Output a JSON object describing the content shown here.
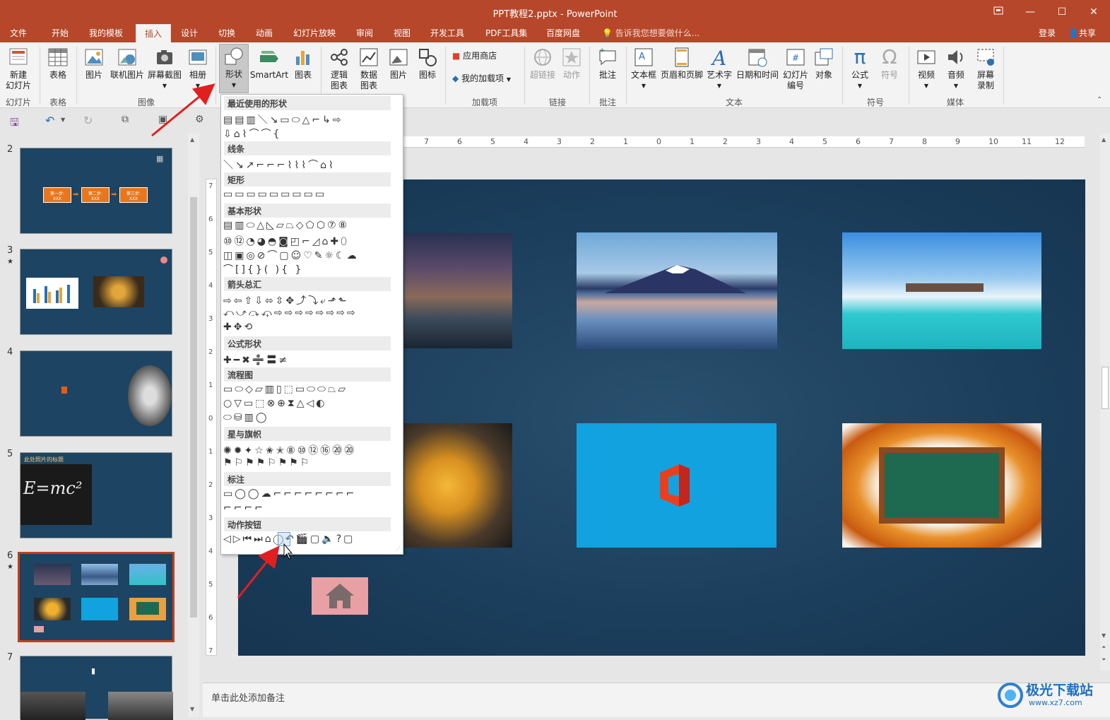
{
  "window": {
    "title": "PPT教程2.pptx - PowerPoint",
    "restore_icon": "ribbon-display-icon",
    "minimize": "—",
    "maximize": "☐",
    "close": "✕"
  },
  "menu": {
    "tabs": [
      "文件",
      "开始",
      "我的模板",
      "插入",
      "设计",
      "切换",
      "动画",
      "幻灯片放映",
      "审阅",
      "视图",
      "开发工具",
      "PDF工具集",
      "百度网盘"
    ],
    "active": "插入",
    "tellme": "告诉我您想要做什么...",
    "login": "登录",
    "share": "共享"
  },
  "ribbon": {
    "buttons": {
      "new_slide": "新建\n幻灯片",
      "table": "表格",
      "picture": "图片",
      "online_picture": "联机图片",
      "screenshot": "屏幕截图",
      "album": "相册",
      "shapes": "形状",
      "smartart": "SmartArt",
      "chart": "图表",
      "logic_chart": "逻辑\n图表",
      "data_chart": "数据\n图表",
      "pic2": "图片",
      "icon": "图标",
      "store": "应用商店",
      "my_addins": "我的加载项",
      "hyperlink": "超链接",
      "action": "动作",
      "comment": "批注",
      "textbox": "文本框",
      "header_footer": "页眉和页脚",
      "wordart": "艺术字",
      "datetime": "日期和时间",
      "slide_number": "幻灯片\n编号",
      "object": "对象",
      "equation": "公式",
      "symbol": "符号",
      "video": "视频",
      "audio": "音频",
      "screen_record": "屏幕\n录制"
    },
    "groups": {
      "slides": "幻灯片",
      "tables": "表格",
      "images": "图像",
      "addins": "加载项",
      "links": "链接",
      "comments": "批注",
      "text": "文本",
      "symbols": "符号",
      "media": "媒体"
    }
  },
  "shapes_menu": {
    "sections": [
      "最近使用的形状",
      "线条",
      "矩形",
      "基本形状",
      "箭头总汇",
      "公式形状",
      "流程图",
      "星与旗帜",
      "标注",
      "动作按钮"
    ],
    "rows": {
      "recent": [
        "▤▤▥＼↘▭⬭△⌐↳⇨",
        "⇩⌂⌇⌒⌒{"
      ],
      "lines": [
        "＼↘↗⌐⌐⌐⌇⌇⌇⌒⌂⌇"
      ],
      "rect": [
        "▭▭▭▭▭▭▭▭▭"
      ],
      "basic": [
        "▤▥⬭△◺▱⏢◇⬠⬡⑦⑧",
        "⑩⑫◔◕◓◙◰⌐◿⌂✚⬯",
        "◫▣◎⊘⌒▢☺♡✎☼☾☁",
        "⌒[]{}( ){ }"
      ],
      "arrows": [
        "⇨⇦⇧⇩⬄⇳✥⤴⤵⤶⬏⬑",
        "⤺⤻⤼⤽⇨⇨⇨⇨⇨⇨⇨⇨",
        "✚✥⟲"
      ],
      "equation": [
        "✚━✖➗〓≠"
      ],
      "flow": [
        "▭⬭◇▱▥▯⬚▭⬭⬭⏢▱",
        "○▽▭⬚⊗⊕⧗△◁◐",
        "⬭⛁▥◯"
      ],
      "stars": [
        "✺✹✦☆✬✭⑧⑩⑫⑯⑳⑳",
        "⚑⚐⚑⚑⚐⚑⚑⚐"
      ],
      "callouts": [
        "▭◯◯☁⌐⌐⌐⌐⌐⌐⌐⌐",
        "⌐⌐⌐⌐"
      ],
      "actions": [
        "◁▷⏮⏭⌂ⓘ↶🎬▢🔈?▢"
      ]
    }
  },
  "thumbnails": {
    "numbers": [
      "2",
      "3",
      "4",
      "5",
      "6",
      "7"
    ],
    "star": "★",
    "slide2": {
      "step1": "第一步:",
      "step2": "第二步:",
      "step3": "第三步:",
      "sub": "XXX"
    },
    "slide5_title": "此处照片的标题",
    "slide5_formula": "E=mc²"
  },
  "ruler": {
    "h_ticks": [
      "7",
      "6",
      "5",
      "4",
      "3",
      "2",
      "1",
      "0",
      "1",
      "2",
      "3",
      "4",
      "5",
      "6",
      "7",
      "8",
      "9",
      "10",
      "11",
      "12"
    ],
    "v_ticks": [
      "7",
      "6",
      "5",
      "4",
      "3",
      "2",
      "1",
      "0",
      "1",
      "2",
      "3",
      "4",
      "5",
      "6",
      "7"
    ]
  },
  "notes": {
    "placeholder": "单击此处添加备注"
  },
  "watermark": {
    "name": "极光下载站",
    "url": "www.xz7.com"
  },
  "colors": {
    "accent": "#b7472a",
    "slide_bg": "#1d4462",
    "office_bg": "#12a2e0",
    "home_button": "#e8a0a4"
  }
}
